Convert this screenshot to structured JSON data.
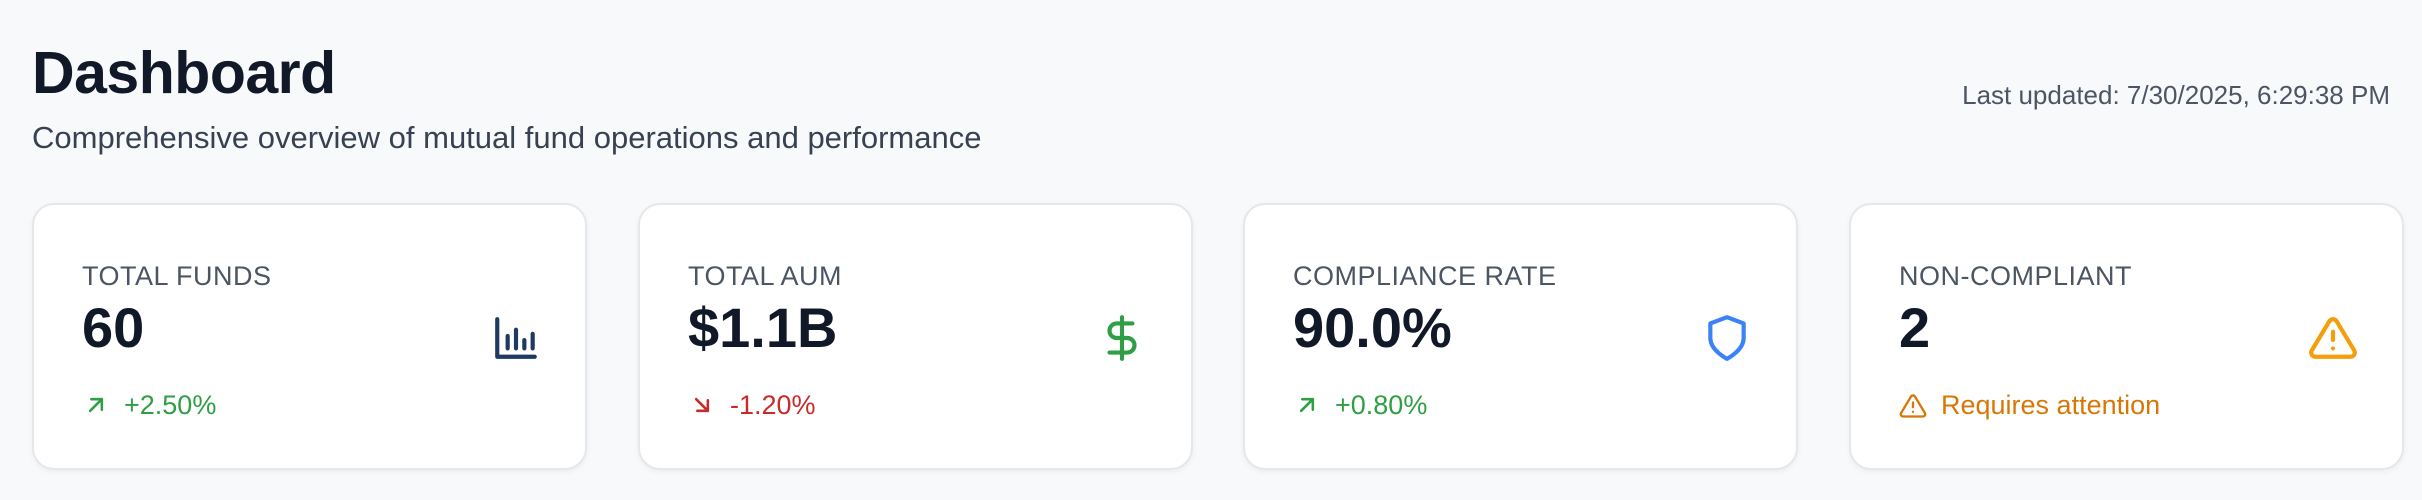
{
  "header": {
    "title": "Dashboard",
    "subtitle": "Comprehensive overview of mutual fund operations and performance",
    "last_updated": "Last updated: 7/30/2025, 6:29:38 PM"
  },
  "cards": [
    {
      "label": "TOTAL FUNDS",
      "value": "60",
      "change": "+2.50%",
      "trend": "up",
      "icon": "bar-chart-icon",
      "icon_color": "#1e3a5f"
    },
    {
      "label": "TOTAL AUM",
      "value": "$1.1B",
      "change": "-1.20%",
      "trend": "down",
      "icon": "dollar-icon",
      "icon_color": "#2f9e44"
    },
    {
      "label": "COMPLIANCE RATE",
      "value": "90.0%",
      "change": "+0.80%",
      "trend": "up",
      "icon": "shield-icon",
      "icon_color": "#3b82f6"
    },
    {
      "label": "NON-COMPLIANT",
      "value": "2",
      "change": "Requires attention",
      "trend": "warning",
      "icon": "alert-triangle-icon",
      "icon_color": "#f59e0b"
    }
  ],
  "colors": {
    "positive": "#2f9e44",
    "negative": "#c92a2a",
    "warning": "#d97706",
    "background": "#f8f9fb"
  }
}
